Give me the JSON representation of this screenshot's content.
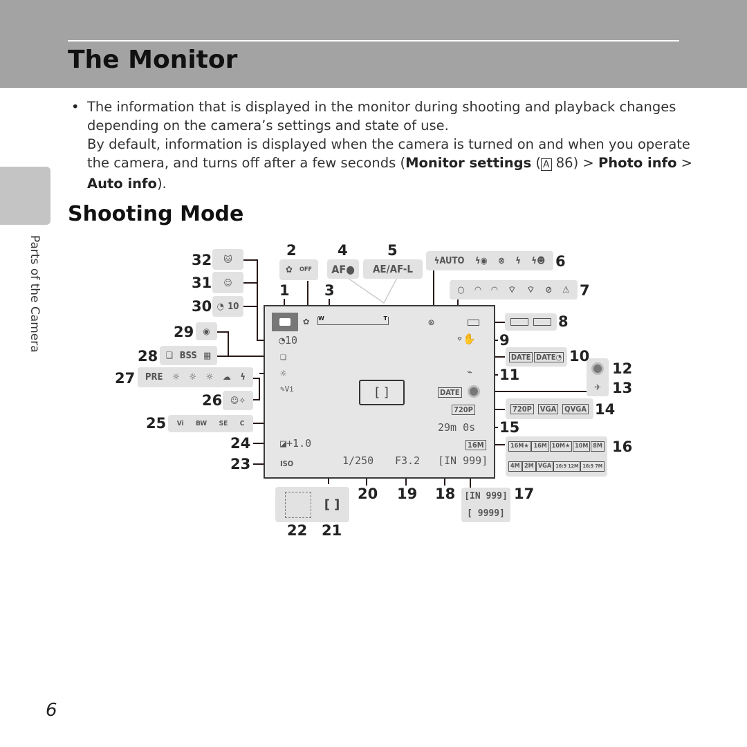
{
  "header": {
    "title": "The Monitor"
  },
  "side_tab": {
    "label": "Parts of the Camera"
  },
  "body": {
    "bullet": "•",
    "line1": "The information that is displayed in the monitor during shooting and playback changes depending on the camera’s settings and state of use.",
    "line2_a": "By default, information is displayed when the camera is turned on and when you operate the camera, and turns off after a few seconds (",
    "line2_b": "Monitor settings",
    "line2_c": " (",
    "ref_icon": "A",
    "line2_d": " 86) > ",
    "line2_e": "Photo info",
    "line2_f": " > ",
    "line2_g": "Auto info",
    "line2_h": ")."
  },
  "section_title": "Shooting Mode",
  "page_number": "6",
  "callouts": [
    "1",
    "2",
    "3",
    "4",
    "5",
    "6",
    "7",
    "8",
    "9",
    "10",
    "11",
    "12",
    "13",
    "14",
    "15",
    "16",
    "17",
    "18",
    "19",
    "20",
    "21",
    "22",
    "23",
    "24",
    "25",
    "26",
    "27",
    "28",
    "29",
    "30",
    "31",
    "32"
  ],
  "icons": {
    "g2": [
      "macro-icon",
      "OFF"
    ],
    "g4": "AF●",
    "g5": "AE/AF-L",
    "g6": [
      "AUTO",
      "red-eye-flash",
      "flash-off",
      "flash-on",
      "slow-sync"
    ],
    "g8_battery": [
      "battery-full",
      "battery-low"
    ],
    "g10": [
      "DATE",
      "DATE◔"
    ],
    "g14": [
      "720P",
      "VGA",
      "QVGA"
    ],
    "g16": [
      "16M★",
      "16M",
      "10M★",
      "10M",
      "8M",
      "4M",
      "2M",
      "VGA",
      "16:9 12M",
      "16:9 7M"
    ],
    "g17": [
      "[IN 999]",
      "[ 9999]"
    ],
    "g25": [
      "Vi",
      "BW",
      "SE",
      "C"
    ],
    "g27": [
      "PRE",
      "☼",
      "☼",
      "☼",
      "☁",
      "ϟ"
    ],
    "g28": [
      "❏",
      "BSS",
      "▦"
    ],
    "g30": "10",
    "monitor": {
      "self_timer": "10",
      "exposure": "+1.0",
      "iso": "ISO",
      "shutter": "1/250",
      "aperture": "F3.2",
      "remaining": "[IN 999]",
      "date": "DATE",
      "movie": "720P",
      "movie_time": "29m 0s",
      "image_size": "16M",
      "zoom_w": "W",
      "zoom_t": "T"
    }
  }
}
